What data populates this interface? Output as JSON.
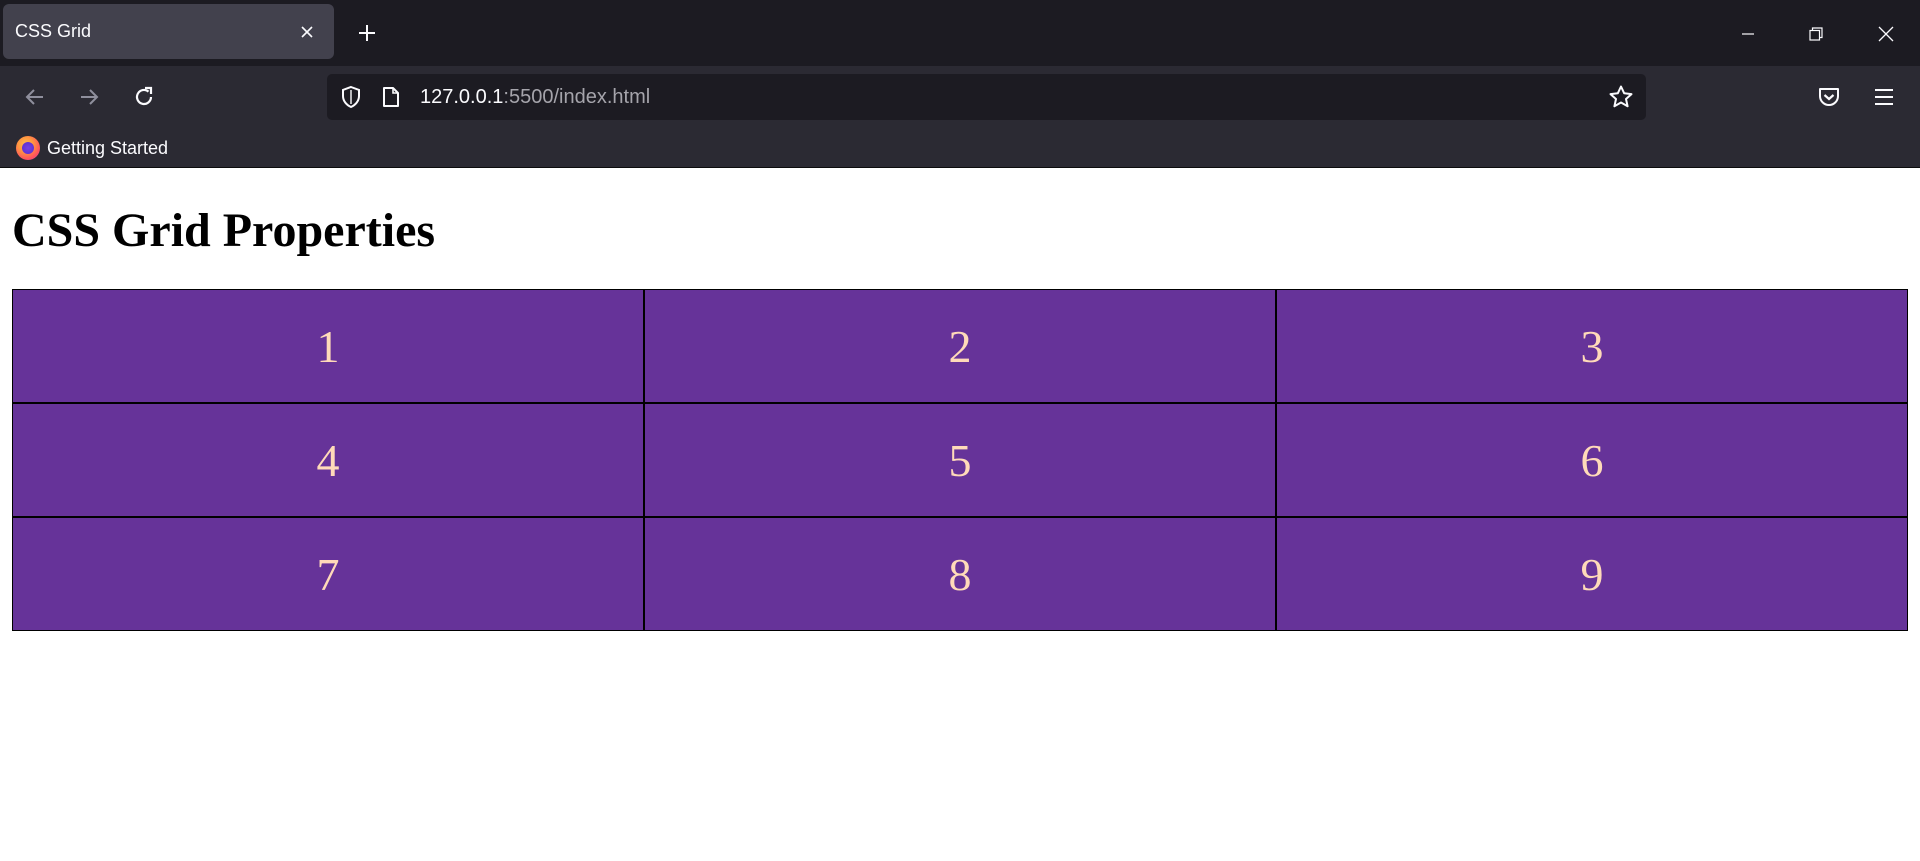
{
  "browser": {
    "tab": {
      "title": "CSS Grid"
    },
    "url": {
      "host": "127.0.0.1",
      "rest": ":5500/index.html"
    },
    "bookmarks": [
      {
        "label": "Getting Started"
      }
    ]
  },
  "page": {
    "heading": "CSS Grid Properties",
    "grid_items": [
      "1",
      "2",
      "3",
      "4",
      "5",
      "6",
      "7",
      "8",
      "9"
    ]
  },
  "colors": {
    "grid_item_background": "#663399",
    "grid_item_text": "#ffdab9",
    "grid_item_border": "#000000"
  }
}
